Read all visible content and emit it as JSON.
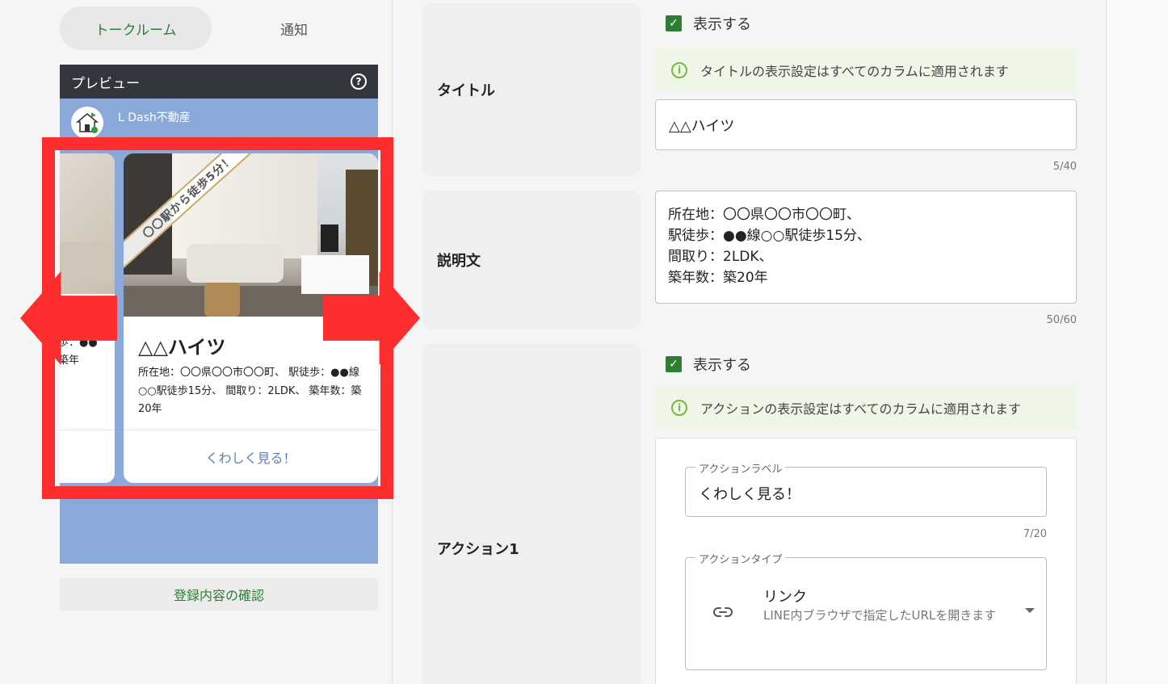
{
  "tabs": {
    "talkroom": "トークルーム",
    "notice": "通知"
  },
  "preview": {
    "header": "プレビュー",
    "account_name": "L Dash不動産",
    "prev_card_lines": [
      "歩：●●",
      "築年"
    ],
    "card": {
      "ribbon": "〇〇駅から徒歩5分！",
      "title": "△△ハイツ",
      "desc": "所在地：〇〇県〇〇市〇〇町、 駅徒歩：●●線○○駅徒歩15分、 間取り：2LDK、 築年数：築20年",
      "action": "くわしく見る！"
    }
  },
  "confirm_button": "登録内容の確認",
  "form": {
    "title_section": {
      "label": "タイトル",
      "show_label": "表示する",
      "info": "タイトルの表示設定はすべてのカラムに適用されます",
      "value": "△△ハイツ",
      "counter": "5/40"
    },
    "desc_section": {
      "label": "説明文",
      "lines": [
        "所在地：〇〇県〇〇市〇〇町、",
        "駅徒歩：●●線○○駅徒歩15分、",
        "間取り：2LDK、",
        "築年数：築20年"
      ],
      "counter": "50/60"
    },
    "action_section": {
      "label": "アクション1",
      "show_label": "表示する",
      "info": "アクションの表示設定はすべてのカラムに適用されます",
      "action_label_legend": "アクションラベル",
      "action_label_value": "くわしく見る！",
      "action_label_counter": "7/20",
      "action_type_legend": "アクションタイプ",
      "action_type_title": "リンク",
      "action_type_desc": "LINE内ブラウザで指定したURLを開きます"
    }
  },
  "icons": {
    "help": "help-circle-icon",
    "check": "checkbox-checked-icon",
    "info": "info-circle-icon",
    "link": "link-icon",
    "dropdown": "caret-down-icon"
  },
  "colors": {
    "accent_green": "#2e7d32",
    "preview_bg": "#8aa9d9",
    "annotation_red": "#ff2e2e",
    "link_blue": "#5b7fbf"
  }
}
